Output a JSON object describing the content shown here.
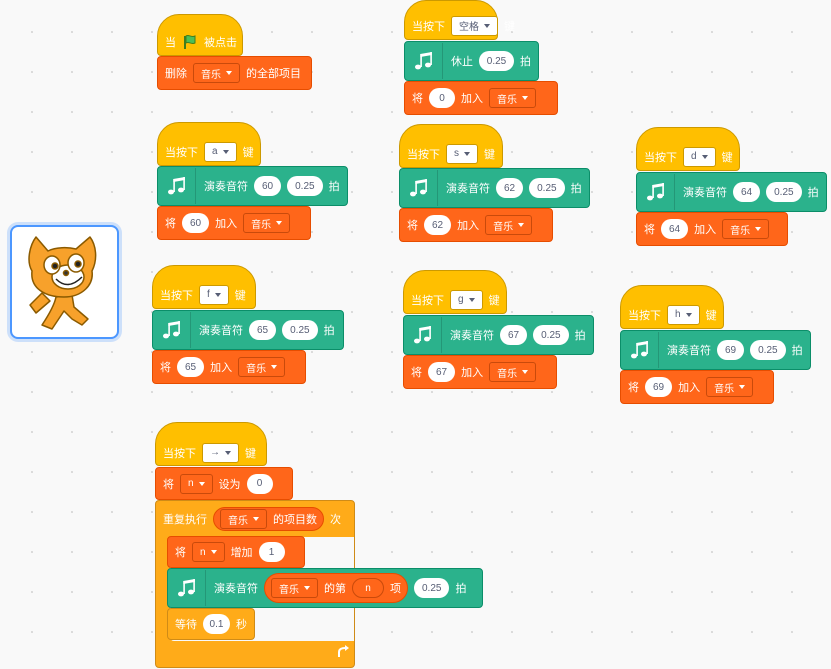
{
  "block_labels": {
    "when": "当",
    "clicked": "被点击",
    "delete_all": "删除",
    "all_items": "的全部项目",
    "when_key_pressed": "当按下",
    "key": "键",
    "rest": "休止",
    "beats": "拍",
    "add": "将",
    "add_into": "加入",
    "play_note": "演奏音符",
    "set": "设为",
    "repeat": "重复执行",
    "item_count": "的项目数",
    "times": "次",
    "change": "增加",
    "of_list": "的第",
    "item": "项",
    "wait": "等待",
    "seconds": "秒"
  },
  "list_name": "音乐",
  "var_name": "n",
  "flag_script": {
    "list": "音乐"
  },
  "space_script": {
    "key": "空格",
    "rest_beats": "0.25",
    "add_value": "0"
  },
  "note_scripts": [
    {
      "key": "a",
      "note": "60",
      "beats": "0.25",
      "add_value": "60"
    },
    {
      "key": "s",
      "note": "62",
      "beats": "0.25",
      "add_value": "62"
    },
    {
      "key": "d",
      "note": "64",
      "beats": "0.25",
      "add_value": "64"
    },
    {
      "key": "f",
      "note": "65",
      "beats": "0.25",
      "add_value": "65"
    },
    {
      "key": "g",
      "note": "67",
      "beats": "0.25",
      "add_value": "67"
    },
    {
      "key": "h",
      "note": "69",
      "beats": "0.25",
      "add_value": "69"
    }
  ],
  "play_script": {
    "key": "→",
    "set_value": "0",
    "change_value": "1",
    "note_beats": "0.25",
    "wait_seconds": "0.1"
  },
  "colors": {
    "events": "#ffbf00",
    "variables": "#ff661a",
    "music": "#2bb28c",
    "control": "#ffab19",
    "selection": "#4c97ff"
  }
}
